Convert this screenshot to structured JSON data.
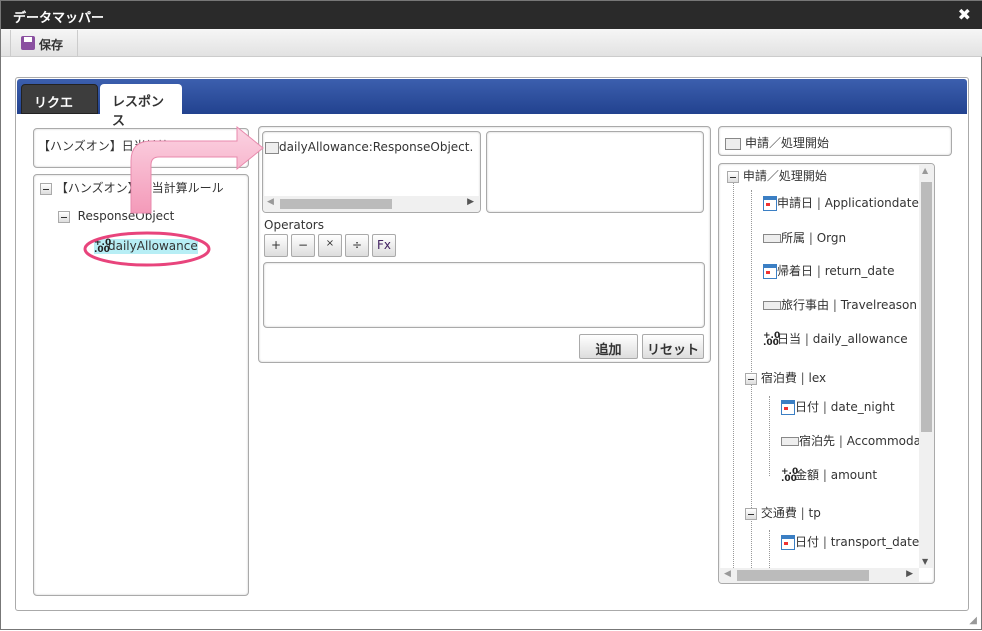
{
  "window": {
    "title": "データマッパー",
    "close": "✖"
  },
  "toolbar": {
    "save": "保存"
  },
  "tabs": [
    {
      "label": "リクエスト"
    },
    {
      "label": "レスポンス"
    }
  ],
  "left": {
    "rule_field": "【ハンズオン】日当計算ルール",
    "tree": {
      "root": "【ハンズオン】日当計算ルール",
      "child": "ResponseObject",
      "leaf": "dailyAllowance"
    }
  },
  "middle": {
    "mapped_item": "dailyAllowance:ResponseObject.【ハンズオン】日当計算ルール",
    "operators_label": "Operators",
    "operators": [
      "+",
      "−",
      "×",
      "÷",
      "Fx"
    ],
    "add": "追加",
    "reset": "リセット"
  },
  "right": {
    "header": "申請／処理開始",
    "tree": [
      {
        "label": "申請／処理開始",
        "level": 0,
        "icon": "folder"
      },
      {
        "label": "申請日",
        "key": "Applicationdate",
        "level": 1,
        "icon": "calendar"
      },
      {
        "label": "所属",
        "key": "Orgn",
        "level": 1,
        "icon": "text"
      },
      {
        "label": "帰着日",
        "key": "return_date",
        "level": 1,
        "icon": "calendar"
      },
      {
        "label": "旅行事由",
        "key": "Travelreason",
        "level": 1,
        "icon": "text"
      },
      {
        "label": "日当",
        "key": "daily_allowance",
        "level": 1,
        "icon": "number"
      },
      {
        "label": "宿泊費",
        "key": "lex",
        "level": 1,
        "icon": "folder"
      },
      {
        "label": "日付",
        "key": "date_night",
        "level": 2,
        "icon": "calendar"
      },
      {
        "label": "宿泊先",
        "key": "Accommodati",
        "level": 2,
        "icon": "text"
      },
      {
        "label": "金額",
        "key": "amount",
        "level": 2,
        "icon": "number"
      },
      {
        "label": "交通費",
        "key": "tp",
        "level": 1,
        "icon": "folder"
      },
      {
        "label": "日付",
        "key": "transport_date",
        "level": 2,
        "icon": "calendar"
      }
    ]
  }
}
